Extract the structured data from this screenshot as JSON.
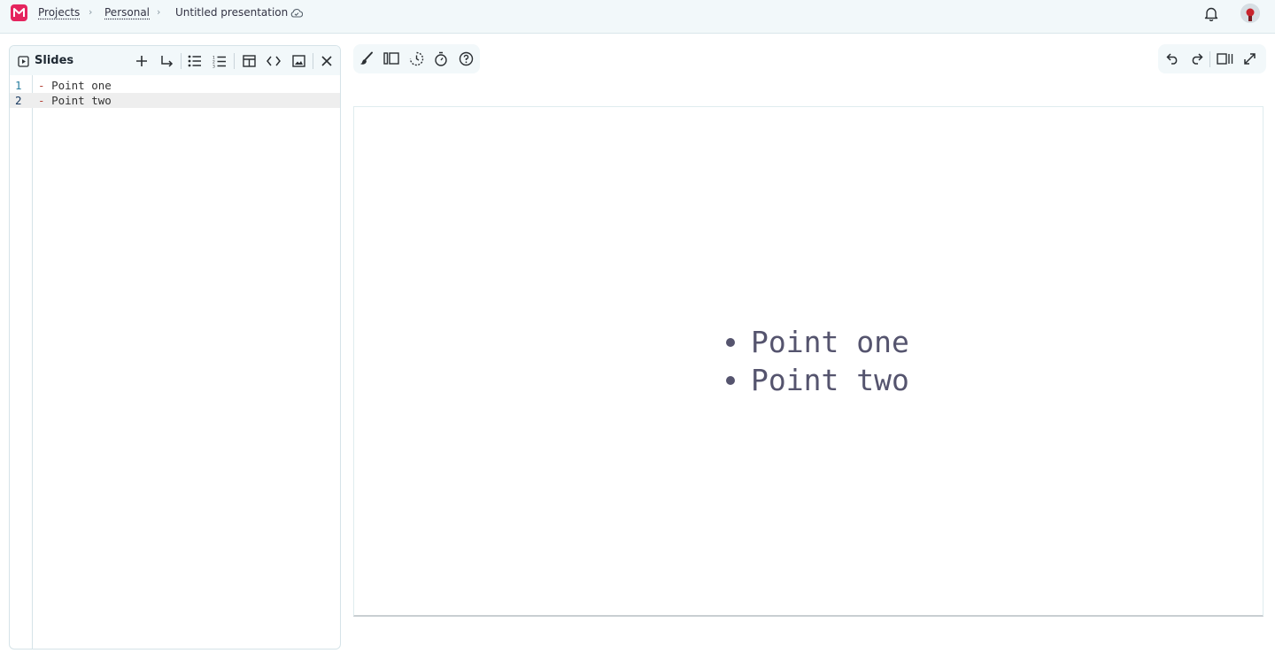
{
  "header": {
    "breadcrumbs": [
      "Projects",
      "Personal",
      "Untitled presentation"
    ],
    "separator": "›",
    "brand_color": "#e5245e"
  },
  "editor": {
    "title": "Slides",
    "toolbar": [
      "plus-icon",
      "enter-arrow-icon",
      "bullet-list-icon",
      "numbered-list-icon",
      "table-icon",
      "code-icon",
      "image-icon",
      "close-icon"
    ],
    "lines": [
      {
        "number": "1",
        "dash": "-",
        "text": "Point one"
      },
      {
        "number": "2",
        "dash": "-",
        "text": "Point two"
      }
    ]
  },
  "canvas_toolbar_left": [
    "brush-icon",
    "layout-icon",
    "history-icon",
    "timer-icon",
    "help-icon"
  ],
  "canvas_toolbar_right": [
    "undo-icon",
    "redo-icon",
    "split-view-icon",
    "fullscreen-icon"
  ],
  "slide": {
    "bullets": [
      "Point one",
      "Point two"
    ],
    "text_color": "#55546e"
  }
}
